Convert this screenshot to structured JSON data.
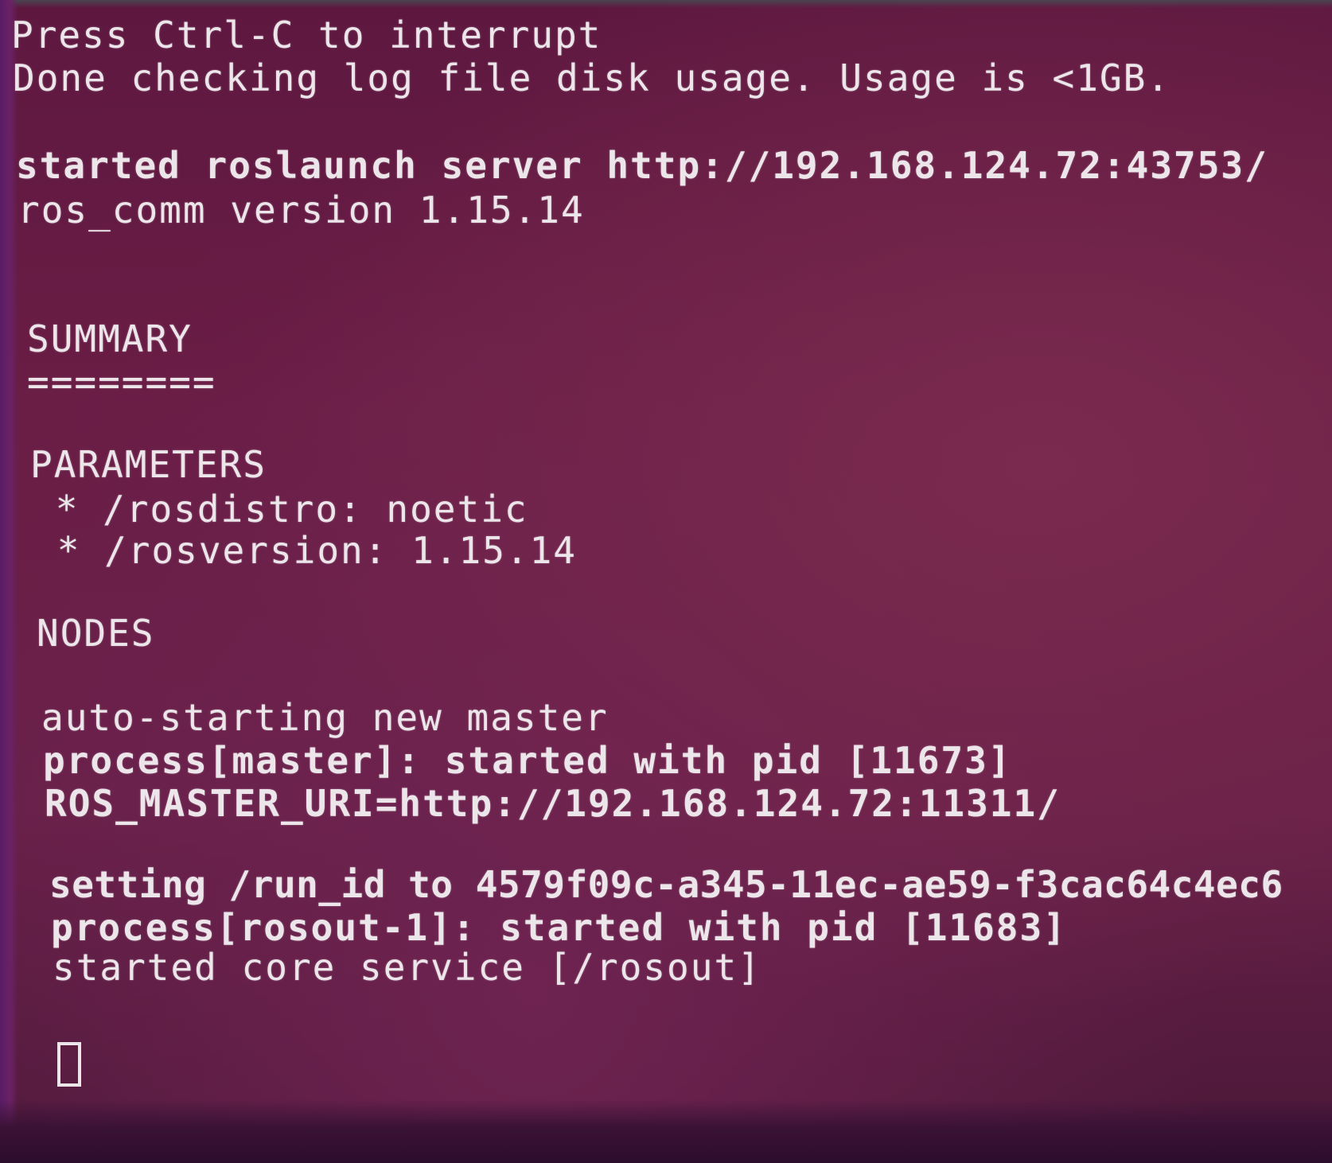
{
  "terminal": {
    "lines": {
      "l1": "Press Ctrl-C to interrupt",
      "l2": "Done checking log file disk usage. Usage is <1GB.",
      "l3": "started roslaunch server http://192.168.124.72:43753/",
      "l4": "ros_comm version 1.15.14",
      "l5": "SUMMARY",
      "l6": "========",
      "l7": "PARAMETERS",
      "l8": " * /rosdistro: noetic",
      "l9": " * /rosversion: 1.15.14",
      "l10": "NODES",
      "l11": "auto-starting new master",
      "l12": "process[master]: started with pid [11673]",
      "l13": "ROS_MASTER_URI=http://192.168.124.72:11311/",
      "l14": "setting /run_id to 4579f09c-a345-11ec-ae59-f3cac64c4ec6",
      "l15": "process[rosout-1]: started with pid [11683]",
      "l16": "started core service [/rosout]"
    },
    "colors": {
      "background": "#6a1d45",
      "text": "#ece6ea"
    }
  }
}
